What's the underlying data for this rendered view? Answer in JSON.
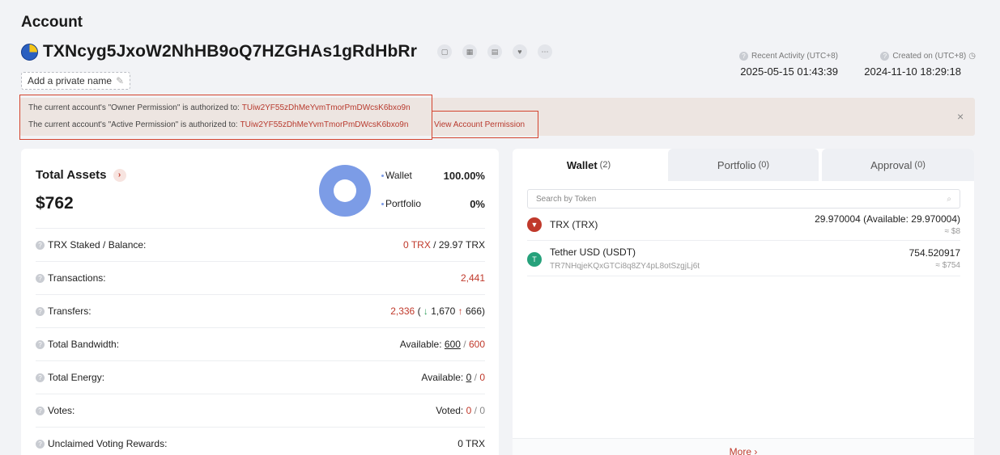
{
  "page": {
    "title": "Account"
  },
  "account": {
    "address": "TXNcyg5JxoW2NhHB9oQ7HZGHAs1gRdHbRr",
    "private_name_label": "Add a private name",
    "recent_activity_label": "Recent Activity (UTC+8)",
    "recent_activity_value": "2025-05-15 01:43:39",
    "created_on_label": "Created on (UTC+8)",
    "created_on_value": "2024-11-10 18:29:18"
  },
  "permissions": {
    "owner_text": "The current account's \"Owner Permission\" is authorized to:",
    "owner_address": "TUiw2YF55zDhMeYvmTmorPmDWcsK6bxo9n",
    "active_text": "The current account's \"Active Permission\" is authorized to:",
    "active_address": "TUiw2YF55zDhMeYvmTmorPmDWcsK6bxo9n",
    "view_link": "View Account Permission",
    "close_icon": "×"
  },
  "assets": {
    "title": "Total Assets",
    "value": "$762",
    "legend": [
      {
        "label": "Wallet",
        "pct": "100.00%"
      },
      {
        "label": "Portfolio",
        "pct": "0%"
      }
    ],
    "wallet_share": 1.0
  },
  "stats": {
    "trx_staked": {
      "label": "TRX Staked / Balance:",
      "staked": "0 TRX",
      "balance": "/ 29.97 TRX"
    },
    "transactions": {
      "label": "Transactions:",
      "value": "2,441"
    },
    "transfers": {
      "label": "Transfers:",
      "total": "2,336",
      "in_arrow": "↓",
      "in": "1,670",
      "out_arrow": "↑",
      "out": "666",
      "open": "(",
      "close": ")"
    },
    "bandwidth": {
      "label": "Total Bandwidth:",
      "prefix": "Available:",
      "available": "600",
      "sep": "/",
      "total": "600"
    },
    "energy": {
      "label": "Total Energy:",
      "prefix": "Available:",
      "available": "0",
      "sep": "/",
      "total": "0"
    },
    "votes": {
      "label": "Votes:",
      "prefix": "Voted:",
      "voted": "0",
      "sep": "/",
      "total": "0"
    },
    "rewards": {
      "label": "Unclaimed Voting Rewards:",
      "value": "0 TRX"
    }
  },
  "tabs": [
    {
      "label": "Wallet",
      "count": "(2)"
    },
    {
      "label": "Portfolio",
      "count": "(0)"
    },
    {
      "label": "Approval",
      "count": "(0)"
    }
  ],
  "search": {
    "placeholder": "Search by Token"
  },
  "tokens": [
    {
      "name": "TRX (TRX)",
      "sub": "",
      "amount": "29.970004 (Available: 29.970004)",
      "usd": "≈ $8"
    },
    {
      "name": "Tether USD (USDT)",
      "sub": "TR7NHqjeKQxGTCi8q8ZY4pL8otSzgjLj6t",
      "amount": "754.520917",
      "usd": "≈ $754"
    }
  ],
  "more_label": "More ›",
  "colors": {
    "accent": "#c0392b",
    "donut": "#7c9ce6",
    "banner": "#ede5e1",
    "highlight_box": "#d4432e"
  },
  "icons": [
    "copy-icon",
    "qr-code-icon",
    "chart-icon",
    "heart-icon",
    "more-icon",
    "pencil-icon",
    "help-icon",
    "clock-icon",
    "search-icon",
    "trx-token-icon",
    "usdt-token-icon"
  ]
}
